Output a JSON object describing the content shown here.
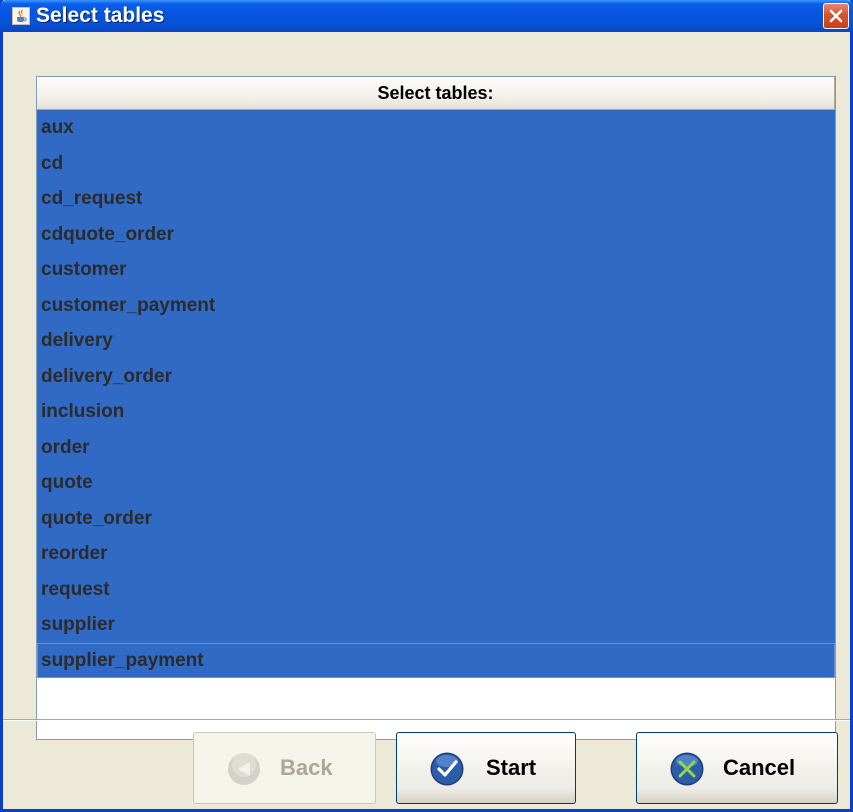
{
  "window": {
    "title": "Select tables"
  },
  "table": {
    "header": "Select tables:",
    "rows": [
      "aux",
      "cd",
      "cd_request",
      "cdquote_order",
      "customer",
      "customer_payment",
      "delivery",
      "delivery_order",
      "inclusion",
      "order",
      "quote",
      "quote_order",
      "reorder",
      "request",
      "supplier",
      "supplier_payment"
    ],
    "selection_color": "#316ac5"
  },
  "buttons": {
    "back": {
      "label": "Back",
      "icon": "back-arrow-icon",
      "enabled": false
    },
    "start": {
      "label": "Start",
      "icon": "checkmark-icon",
      "enabled": true
    },
    "cancel": {
      "label": "Cancel",
      "icon": "x-mark-icon",
      "enabled": true
    }
  },
  "colors": {
    "titlebar": "#0655e1",
    "close_button": "#d9532b",
    "window_background": "#ece9d8"
  }
}
